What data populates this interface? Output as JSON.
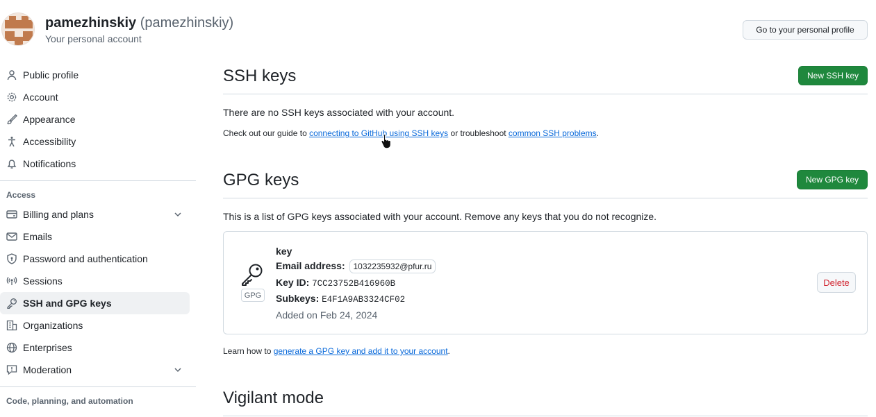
{
  "user": {
    "name": "pamezhinskiy",
    "login": "(pamezhinskiy)",
    "subtitle": "Your personal account",
    "profile_button": "Go to your personal profile"
  },
  "sidebar": {
    "items": [
      {
        "label": "Public profile",
        "icon": "person-icon"
      },
      {
        "label": "Account",
        "icon": "gear-icon"
      },
      {
        "label": "Appearance",
        "icon": "paintbrush-icon"
      },
      {
        "label": "Accessibility",
        "icon": "accessibility-icon"
      },
      {
        "label": "Notifications",
        "icon": "bell-icon"
      }
    ],
    "access_heading": "Access",
    "access_items": [
      {
        "label": "Billing and plans",
        "icon": "credit-card-icon",
        "expandable": true
      },
      {
        "label": "Emails",
        "icon": "mail-icon"
      },
      {
        "label": "Password and authentication",
        "icon": "shield-lock-icon"
      },
      {
        "label": "Sessions",
        "icon": "broadcast-icon"
      },
      {
        "label": "SSH and GPG keys",
        "icon": "key-icon",
        "active": true
      },
      {
        "label": "Organizations",
        "icon": "organization-icon"
      },
      {
        "label": "Enterprises",
        "icon": "globe-icon"
      },
      {
        "label": "Moderation",
        "icon": "report-icon",
        "expandable": true
      }
    ],
    "code_heading": "Code, planning, and automation"
  },
  "ssh": {
    "title": "SSH keys",
    "new_button": "New SSH key",
    "empty_text": "There are no SSH keys associated with your account.",
    "guide_prefix": "Check out our guide to ",
    "guide_link": "connecting to GitHub using SSH keys",
    "guide_mid": " or troubleshoot ",
    "problems_link": "common SSH problems",
    "guide_suffix": "."
  },
  "gpg": {
    "title": "GPG keys",
    "new_button": "New GPG key",
    "description": "This is a list of GPG keys associated with your account. Remove any keys that you do not recognize.",
    "key": {
      "badge": "GPG",
      "name": "key",
      "email_label": "Email address:",
      "email": "1032235932@pfur.ru",
      "keyid_label": "Key ID:",
      "keyid": "7CC23752B416960B",
      "subkeys_label": "Subkeys:",
      "subkeys": "E4F1A9AB3324CF02",
      "added": "Added on Feb 24, 2024",
      "delete_button": "Delete"
    },
    "learn_prefix": "Learn how to ",
    "learn_link": "generate a GPG key and add it to your account",
    "learn_suffix": "."
  },
  "vigilant": {
    "title": "Vigilant mode"
  },
  "colors": {
    "primary_green": "#1f883d",
    "link_blue": "#0969da",
    "danger_red": "#d1242f",
    "border": "#d1d9e0"
  }
}
